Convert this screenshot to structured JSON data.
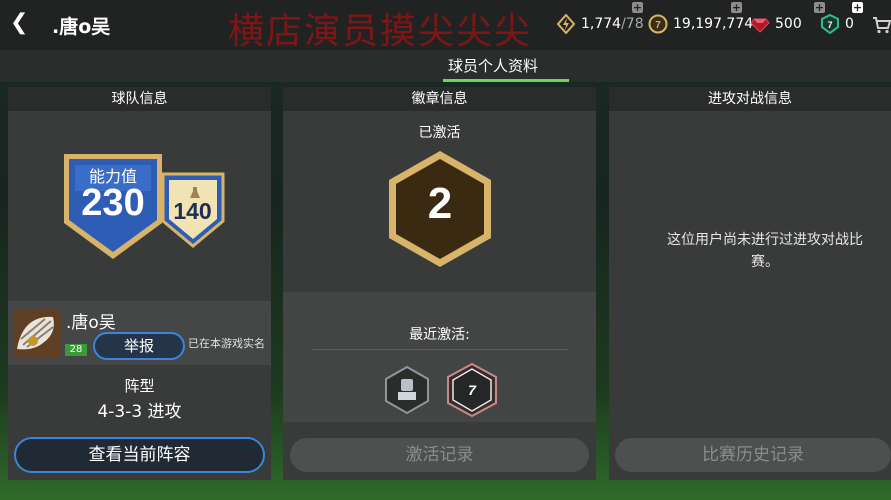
{
  "header": {
    "player_name": ".唐o吴",
    "watermark": "横店演员摸尖尖尖",
    "energy": "1,774",
    "energy_max": "/78",
    "coins": "19,197,774",
    "gems": "500",
    "tokens": "0"
  },
  "tab": {
    "label": "球员个人资料"
  },
  "team_panel": {
    "title": "球队信息",
    "rating_label": "能力值",
    "rating": "230",
    "sub_rating": "140",
    "player_name": ".唐o吴",
    "level": "28",
    "report_button": "举报",
    "realname_note": "已在本游戏实名",
    "formation_label": "阵型",
    "formation": "4-3-3 进攻",
    "view_lineup_button": "查看当前阵容"
  },
  "badge_panel": {
    "title": "徽章信息",
    "activated_label": "已激活",
    "activated_count": "2",
    "recent_label": "最近激活:",
    "history_button": "激活记录"
  },
  "attack_panel": {
    "title": "进攻对战信息",
    "empty_message": "这位用户尚未进行过进攻对战比赛。",
    "history_button": "比赛历史记录"
  },
  "colors": {
    "accent_green": "#6cd65f",
    "button_border": "#3b86d9",
    "rating_blue": "#2e5db5",
    "gold": "#d7b46a"
  }
}
